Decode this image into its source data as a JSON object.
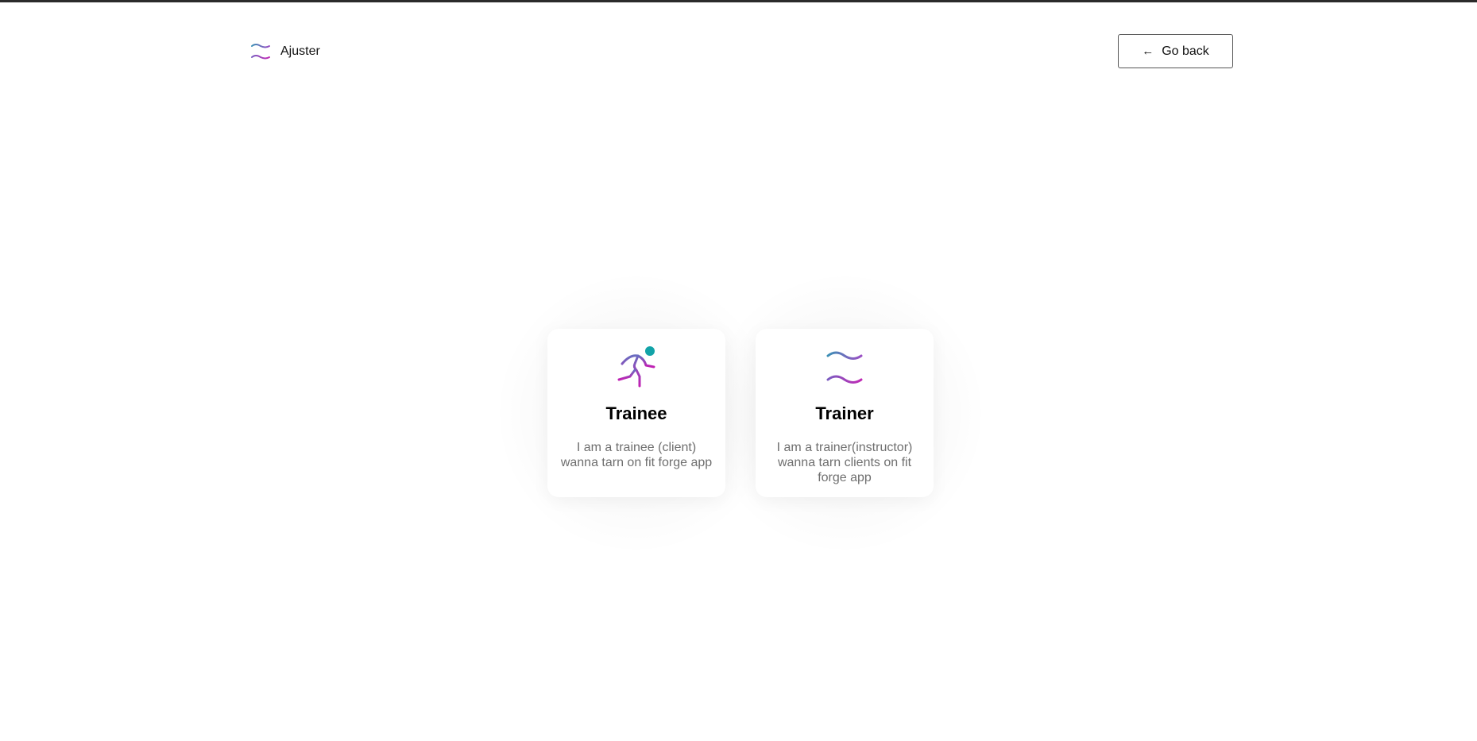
{
  "header": {
    "brand_name": "Ajuster",
    "back_label": "Go back"
  },
  "roles": [
    {
      "title": "Trainee",
      "description": "I am a trainee (client) wanna tarn on fit forge app",
      "icon": "running-person-icon"
    },
    {
      "title": "Trainer",
      "description": "I am a trainer(instructor) wanna tarn clients on fit forge app",
      "icon": "dumbbells-icon"
    }
  ],
  "colors": {
    "accent_blue": "#4a7fb8",
    "accent_purple": "#8a4fc0",
    "accent_magenta": "#b52bb8",
    "accent_teal": "#12a3a8"
  }
}
